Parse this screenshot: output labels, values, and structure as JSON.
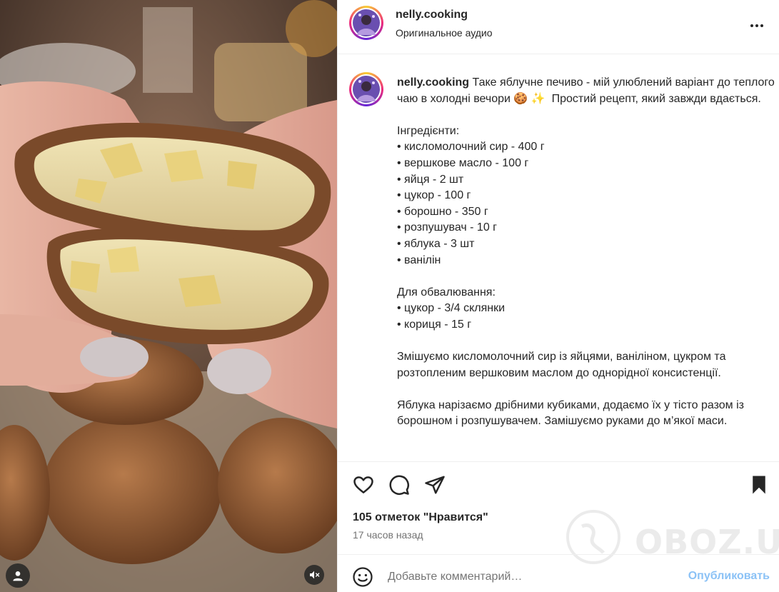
{
  "header": {
    "username": "nelly.cooking",
    "audio": "Оригинальное аудио",
    "more_icon": "more-horizontal-icon"
  },
  "caption": {
    "username": "nelly.cooking",
    "text": " Таке яблучне печиво - мій улюблений варіант до теплого чаю в холодні вечори 🍪 ✨  Простий рецепт, який завжди вдається.\n\nІнгредієнти:\n• кисломолочний сир - 400 г\n• вершкове масло - 100 г\n• яйця - 2 шт\n• цукор - 100 г\n• борошно - 350 г\n• розпушувач - 10 г\n• яблука - 3 шт\n• ванілін\n\nДля обвалювання:\n• цукор - 3/4 склянки\n• кориця - 15 г\n\nЗмішуємо кисломолочний сир із яйцями, ваніліном, цукром та розтопленим вершковим маслом до однорідної консистенції.\n\nЯблука нарізаємо дрібними кубиками, додаємо їх у тісто разом із борошном і розпушувачем. Замішуємо руками до м’якої маси."
  },
  "actions": {
    "like_icon": "heart-icon",
    "comment_icon": "comment-icon",
    "share_icon": "share-icon",
    "save_icon": "bookmark-icon"
  },
  "likes": "105 отметок \"Нравится\"",
  "time": "17 часов назад",
  "comment": {
    "placeholder": "Добавьте комментарий…",
    "post_label": "Опубликовать",
    "post_color": "#8bc2f6"
  },
  "watermark": "OBOZ.UA",
  "media": {
    "user_tag_icon": "user-icon",
    "mute_icon": "speaker-muted-icon"
  }
}
